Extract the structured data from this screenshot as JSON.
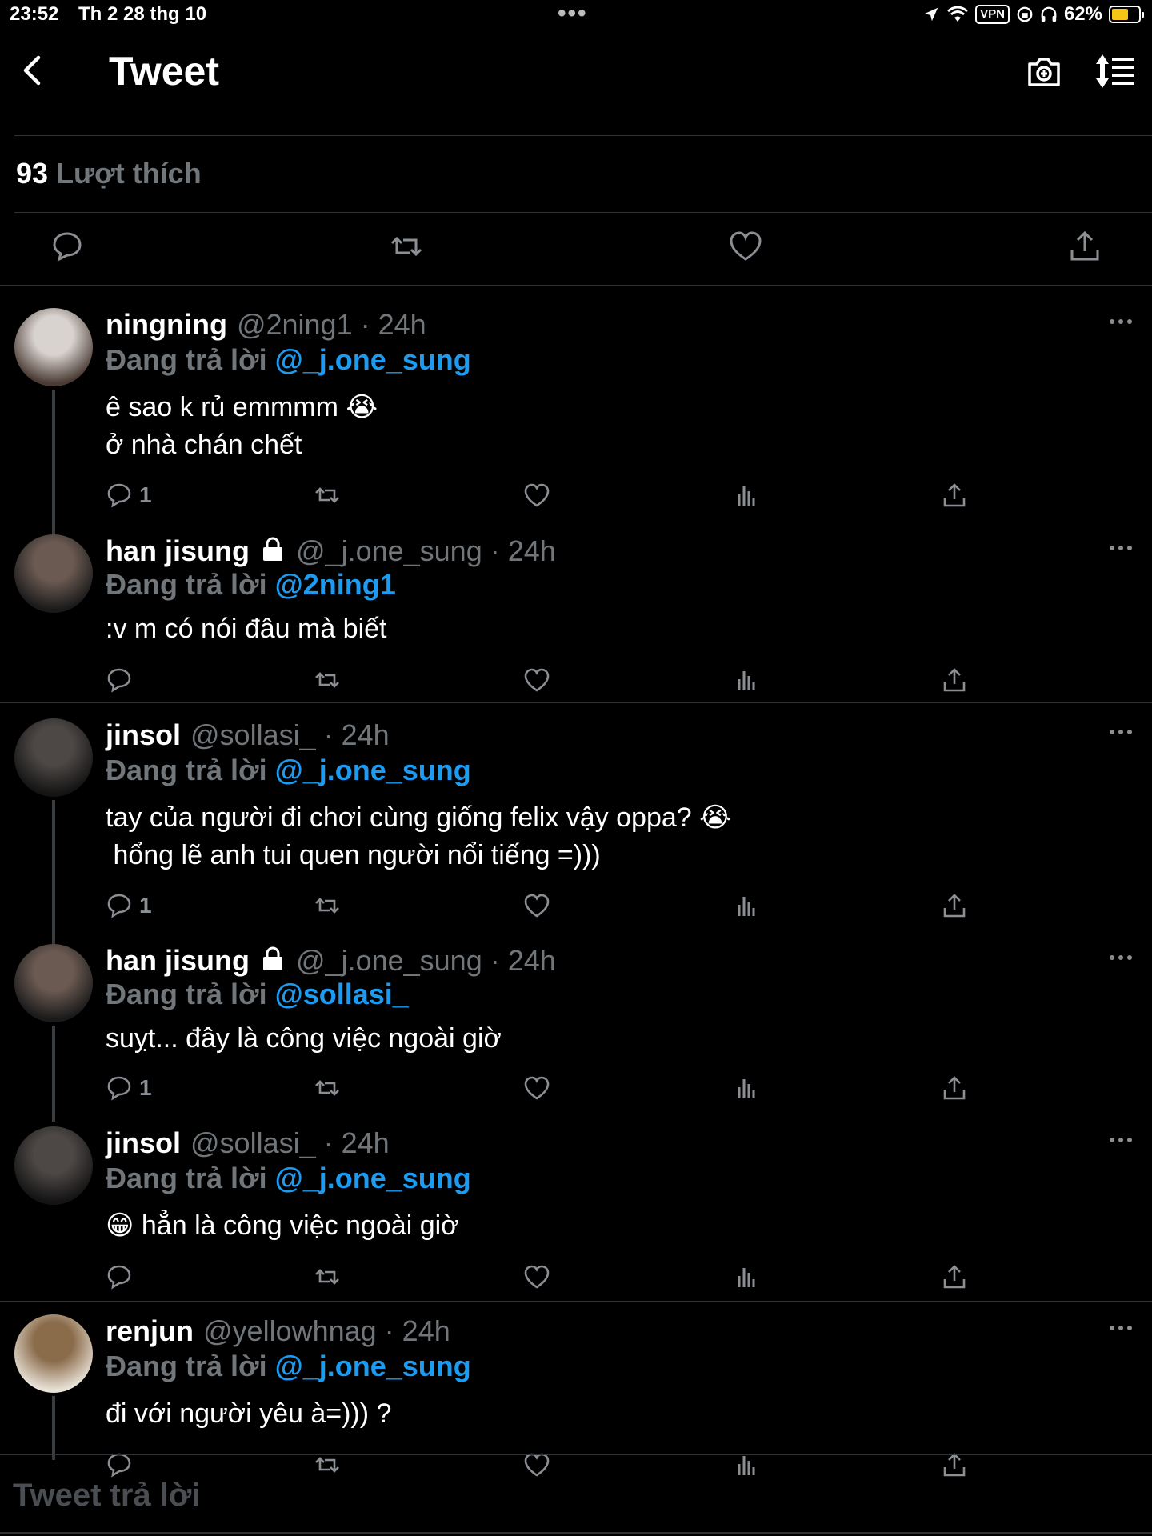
{
  "status_bar": {
    "time": "23:52",
    "date": "Th 2 28 thg 10",
    "dots": "•••",
    "vpn": "VPN",
    "battery": "62%",
    "battery_level": 0.62
  },
  "header": {
    "title": "Tweet",
    "icons": [
      "back-icon",
      "camera-icon",
      "sort-icon"
    ]
  },
  "tweet_stats": {
    "likes_count": "93",
    "likes_label": "Lượt thích"
  },
  "tweet_actions": [
    "reply-icon",
    "retweet-icon",
    "like-icon",
    "share-icon"
  ],
  "replying_label": "Đang trả lời",
  "replies": [
    {
      "name": "ningning",
      "handle": "@2ning1 · 24h",
      "reply_to": "@_j.one_sung",
      "text": "ê sao k rủ emmmm 😭\nở nhà chán chết",
      "reply_count": "1",
      "locked": false
    },
    {
      "name": "han jisung",
      "handle": "@_j.one_sung · 24h",
      "reply_to": "@2ning1",
      "text": ":v m có nói đâu mà biết",
      "reply_count": "",
      "locked": true
    },
    {
      "name": "jinsol",
      "handle": "@sollasi_ · 24h",
      "reply_to": "@_j.one_sung",
      "text": "tay của người đi chơi cùng giống felix vậy oppa? 😭\n hổng lẽ anh tui quen người nổi tiếng =)))",
      "reply_count": "1",
      "locked": false
    },
    {
      "name": "han jisung",
      "handle": "@_j.one_sung · 24h",
      "reply_to": "@sollasi_",
      "text": "suỵt... đây là công việc ngoài giờ",
      "reply_count": "1",
      "locked": true
    },
    {
      "name": "jinsol",
      "handle": "@sollasi_ · 24h",
      "reply_to": "@_j.one_sung",
      "text": "😁 hẳn là công việc ngoài giờ",
      "reply_count": "",
      "locked": false
    },
    {
      "name": "renjun",
      "handle": "@yellowhnag · 24h",
      "reply_to": "@_j.one_sung",
      "text": "đi với người yêu à=))) ?",
      "reply_count": "",
      "locked": false
    }
  ],
  "compose": {
    "placeholder": "Tweet trả lời"
  }
}
